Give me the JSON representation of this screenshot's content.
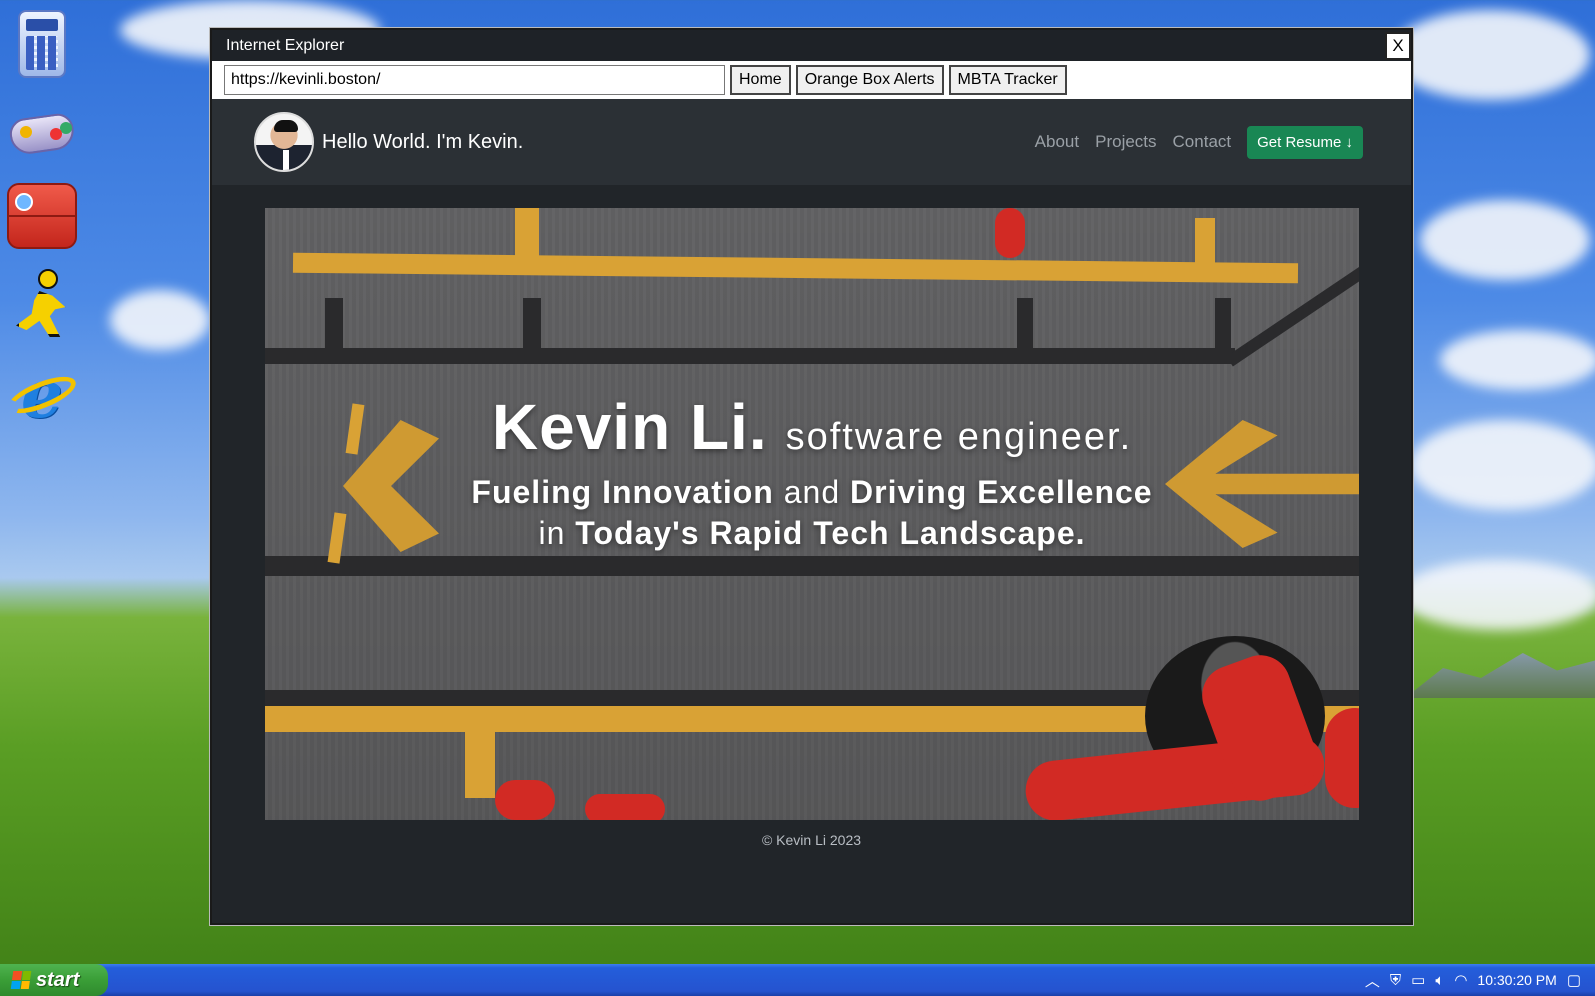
{
  "colors": {
    "accent_green": "#198754",
    "nav_bg": "#2b3035",
    "page_bg": "#212529",
    "title_bar": "#1e2227"
  },
  "desktop": {
    "icons": [
      {
        "name": "calculator-icon"
      },
      {
        "name": "gamepad-icon"
      },
      {
        "name": "red-app-icon"
      },
      {
        "name": "aim-running-man-icon"
      },
      {
        "name": "internet-explorer-icon"
      }
    ]
  },
  "window": {
    "title": "Internet Explorer",
    "close_label": "X",
    "url": "https://kevinli.boston/",
    "buttons": {
      "home": "Home",
      "orange_box": "Orange Box Alerts",
      "mbta": "MBTA Tracker"
    }
  },
  "site": {
    "brand": "Hello World. I'm Kevin.",
    "nav": {
      "about": "About",
      "projects": "Projects",
      "contact": "Contact",
      "resume": "Get Resume ↓"
    },
    "hero": {
      "name": "Kevin Li.",
      "role": "software engineer.",
      "line1_a": "Fueling Innovation",
      "line1_and": "and",
      "line1_b": "Driving Excellence",
      "line2_in": "in",
      "line2_b": "Today's Rapid Tech Landscape."
    },
    "footer": "© Kevin Li 2023"
  },
  "taskbar": {
    "start": "start",
    "clock": "10:30:20 PM",
    "tray_icons": [
      "chevron-up-icon",
      "shield-icon",
      "battery-icon",
      "speaker-icon",
      "wifi-icon",
      "notification-icon"
    ]
  }
}
